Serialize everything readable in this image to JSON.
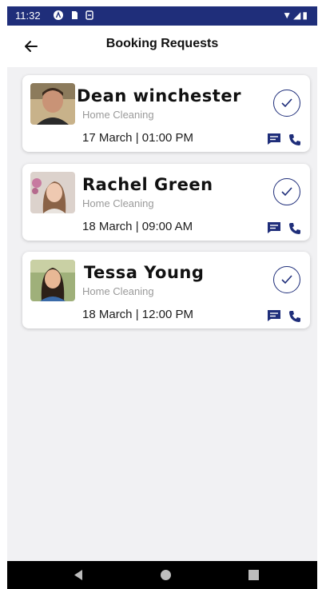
{
  "status_bar": {
    "time": "11:32",
    "right_icons": "▼◢▮"
  },
  "app_bar": {
    "title": "Booking Requests"
  },
  "bookings": [
    {
      "name": "Dean winchester",
      "service": "Home Cleaning",
      "datetime": "17 March | 01:00 PM"
    },
    {
      "name": "Rachel Green",
      "service": "Home Cleaning",
      "datetime": "18 March | 09:00 AM"
    },
    {
      "name": "Tessa Young",
      "service": "Home Cleaning",
      "datetime": "18 March | 12:00 PM"
    }
  ],
  "colors": {
    "accent": "#1f2e7a",
    "background": "#f1f1f3",
    "card": "#ffffff",
    "muted_text": "#9a9a9a"
  }
}
